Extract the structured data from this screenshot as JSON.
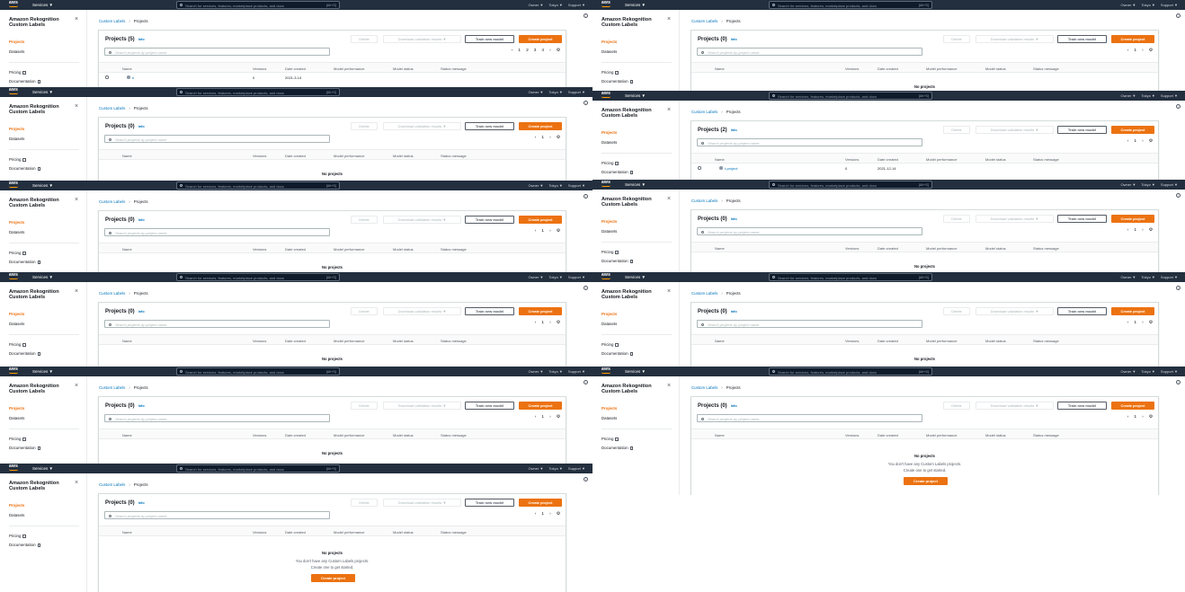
{
  "nav": {
    "logo": "aws",
    "services": "Services ▼",
    "search_placeholder": "Search for services, features, marketplace products, and docs",
    "search_shortcut": "[Alt+S]",
    "region": "Tokyo ▼",
    "support": "Support ▼",
    "account": "Owner ▼"
  },
  "sidebar": {
    "title": "Amazon Rekognition Custom Labels",
    "close": "×",
    "projects": "Projects",
    "datasets": "Datasets",
    "pricing": "Pricing",
    "documentation": "Documentation"
  },
  "breadcrumb": {
    "root": "Custom Labels",
    "current": "Projects"
  },
  "card": {
    "info": "Info",
    "delete": "Delete",
    "download": "Download validation results ▼",
    "train": "Train new model",
    "create": "Create project",
    "search_placeholder": "Search projects by project name",
    "columns": [
      "Name",
      "Versions",
      "Date created",
      "Model performance",
      "Model status",
      "Status message"
    ],
    "prev": "‹",
    "next": "›",
    "page": "1",
    "gear": "⚙"
  },
  "panels": [
    {
      "title": "Projects (5)",
      "row": {
        "name": "e",
        "versions": "0",
        "date": "2021-3-14"
      },
      "pages": [
        "1",
        "2",
        "3",
        "4"
      ]
    },
    {
      "title": "Projects (0)",
      "empty": "No projects"
    },
    {
      "title": "Projects (0)",
      "empty": "No projects"
    },
    {
      "title": "Projects (2)",
      "row": {
        "name": "t-project",
        "versions": "0",
        "date": "2021-12-14"
      }
    },
    {
      "title": "Projects (0)",
      "empty": "No projects"
    },
    {
      "title": "Projects (0)",
      "empty": "No projects"
    },
    {
      "title": "Projects (0)",
      "empty": "No projects"
    },
    {
      "title": "Projects (0)",
      "empty": "No projects"
    },
    {
      "title": "Projects (0)",
      "empty": "No projects"
    },
    {
      "title": "Projects (0)",
      "empty": "No projects",
      "empty_sub1": "You don't have any Custom Labels projects.",
      "empty_sub2": "Create one to get started.",
      "empty_btn": "Create project"
    },
    {
      "title": "Projects (0)",
      "empty": "No projects",
      "empty_sub1": "You don't have any Custom Labels projects.",
      "empty_sub2": "Create one to get started.",
      "empty_btn": "Create project"
    }
  ]
}
